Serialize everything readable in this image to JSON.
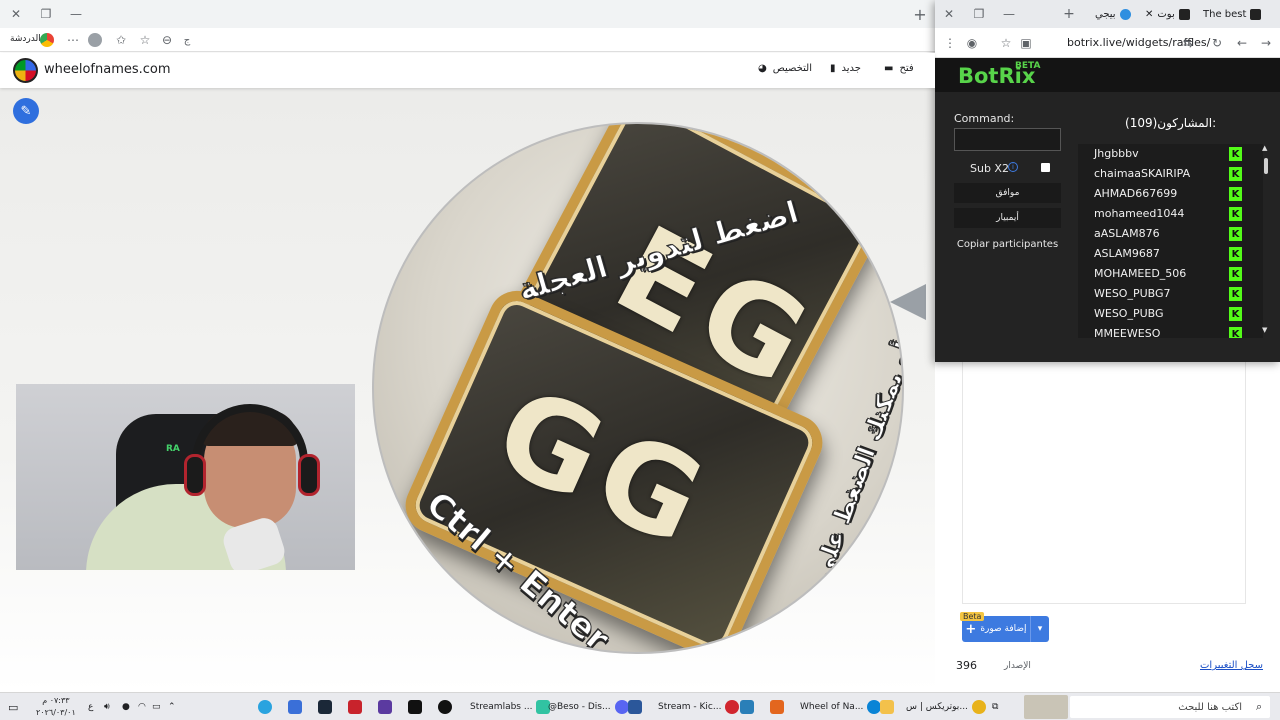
{
  "main_window": {
    "addressbar": {
      "zoom_label": "الدردشة"
    },
    "site": {
      "title": "wheelofnames.com",
      "menu": [
        {
          "label": "التخصيص",
          "icon": "palette-icon"
        },
        {
          "label": "جديد",
          "icon": "file-icon"
        },
        {
          "label": "فتح",
          "icon": "folder-open-icon"
        }
      ]
    },
    "wheel": {
      "text_top": "اضغط لتدوير العجلة",
      "text_side": "أو يمكنك الضغط على زر",
      "text_keys": "Ctrl + Enter"
    },
    "side_panel": {
      "add_button": "إضافة صورة",
      "beta": "Beta",
      "version_label": "الإصدار",
      "version_value": "396",
      "history_link": "سجل التغييرات"
    }
  },
  "popup_window": {
    "tabs": [
      {
        "label": "The best",
        "icon": "kick-tab-icon"
      },
      {
        "label": "بوت",
        "icon": "botrix-tab-icon"
      },
      {
        "label": "بيجي",
        "icon": "edge-tab-icon"
      }
    ],
    "url": "botrix.live/widgets/raffles/",
    "botrix": {
      "logo": "BotRix",
      "beta": "BETA",
      "command_label": "Command:",
      "command_value": "",
      "sub_label": "Sub X2",
      "sub_checked": false,
      "button_ok": "موافق",
      "button_clear": "أيمبيار",
      "copy_label": "Copiar participantes",
      "participants_title": "المشاركون(109):",
      "participants": [
        "Jhgbbbv",
        "chaimaaSKAIRIPA",
        "AHMAD667699",
        "mohameed1044",
        "aASLAM876",
        "ASLAM9687",
        "MOHAMEED_506",
        "WESO_PUBG7",
        "WESO_PUBG",
        "MMEEWESO"
      ],
      "platform_icon": "kick-icon"
    }
  },
  "taskbar": {
    "clock_time": "٠٧:٣٣ م",
    "clock_date": "٢٠٢٦/٠٣/٠١",
    "lang": "ع",
    "search_placeholder": "اكتب هنا للبحث",
    "apps": [
      {
        "label": "Streamlabs ...",
        "color": "#31c3a2"
      },
      {
        "label": "@Beso - Dis...",
        "color": "#5865f2"
      },
      {
        "label": "Stream - Kic...",
        "color": "#53fc18"
      },
      {
        "label": "Wheel of Na...",
        "color": "#0a84d6"
      },
      {
        "label": "بوتريكس | س...",
        "color": "#e8b21a"
      }
    ]
  },
  "colors": {
    "botrix_green": "#58d44a",
    "kick_green": "#53fc18",
    "accent_blue": "#3d7ae0"
  }
}
